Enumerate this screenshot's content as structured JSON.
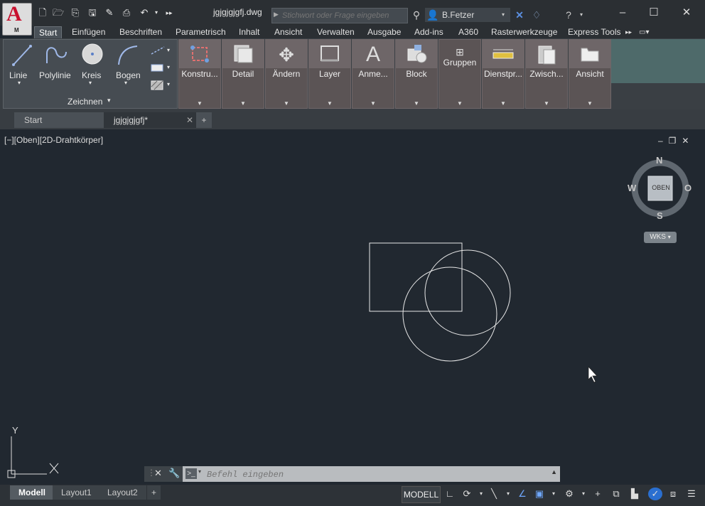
{
  "app": {
    "letter": "A",
    "sub": "M"
  },
  "doc_title": "jgjgjgjgfj.dwg",
  "search": {
    "placeholder": "Stichwort oder Frage eingeben"
  },
  "user": {
    "name": "B.Fetzer"
  },
  "ribbon_tabs": [
    "Start",
    "Einfügen",
    "Beschriften",
    "Parametrisch",
    "Inhalt",
    "Ansicht",
    "Verwalten",
    "Ausgabe",
    "Add-ins",
    "A360",
    "Rasterwerkzeuge",
    "Express Tools"
  ],
  "draw_panel": {
    "tools": [
      "Linie",
      "Polylinie",
      "Kreis",
      "Bogen"
    ],
    "title": "Zeichnen"
  },
  "panels": [
    "Konstru...",
    "Detail",
    "Ändern",
    "Layer",
    "Anme...",
    "Block",
    "Gruppen",
    "Dienstpr...",
    "Zwisch...",
    "Ansicht"
  ],
  "file_tabs": {
    "start": "Start",
    "doc": "jgjgjgjgfj*",
    "add": "+"
  },
  "viewport": {
    "label": "[−][Oben][2D-Drahtkörper]"
  },
  "viewcube": {
    "n": "N",
    "s": "S",
    "w": "W",
    "e": "O",
    "face": "OBEN",
    "ucs": "WKS"
  },
  "ucs_icon": {
    "y": "Y",
    "x": "X"
  },
  "command": {
    "placeholder": "Befehl eingeben"
  },
  "layout_tabs": [
    "Modell",
    "Layout1",
    "Layout2"
  ],
  "status": {
    "model": "MODELL"
  }
}
